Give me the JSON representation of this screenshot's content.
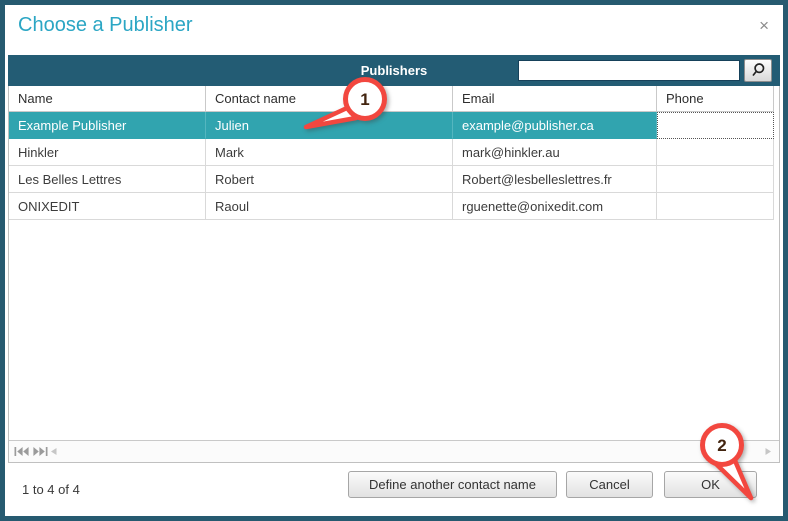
{
  "window": {
    "title": "Choose a Publisher",
    "close_symbol": "×"
  },
  "grid": {
    "caption": "Publishers",
    "search_value": "",
    "columns": [
      "Name",
      "Contact name",
      "Email",
      "Phone"
    ],
    "rows": [
      {
        "name": "Example Publisher",
        "contact": "Julien",
        "email": "example@publisher.ca",
        "phone": ""
      },
      {
        "name": "Hinkler",
        "contact": "Mark",
        "email": "mark@hinkler.au",
        "phone": ""
      },
      {
        "name": "Les Belles Lettres",
        "contact": "Robert",
        "email": "Robert@lesbelleslettres.fr",
        "phone": ""
      },
      {
        "name": "ONIXEDIT",
        "contact": "Raoul",
        "email": "rguenette@onixedit.com",
        "phone": ""
      }
    ],
    "selected_row_index": 0,
    "record_range": "1 to 4 of 4"
  },
  "footer": {
    "define_button": "Define another contact name",
    "cancel_button": "Cancel",
    "ok_button": "OK"
  },
  "callouts": [
    {
      "label": "1"
    },
    {
      "label": "2"
    }
  ],
  "colors": {
    "dialog_border": "#265a70",
    "title_text": "#2ba6c4",
    "caption_bar": "#235c74",
    "selected_row": "#31a4af",
    "callout_red": "#f2473f"
  }
}
